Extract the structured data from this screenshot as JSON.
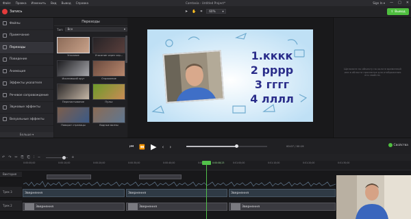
{
  "menu": [
    "Файл",
    "Правка",
    "Изменить",
    "Вид",
    "Вывод",
    "Справка"
  ],
  "app_title": "Camtasia - Untitled Project*",
  "signin": "Sign In ▾",
  "window_controls": [
    "—",
    "□",
    "✕"
  ],
  "toolbar": {
    "record_label": "Запись",
    "zoom_value": "60%",
    "export_label": "Вывод"
  },
  "nav": [
    {
      "label": "Файлы",
      "icon": "folder-icon"
    },
    {
      "label": "Примечание",
      "icon": "callout-icon"
    },
    {
      "label": "Переходы",
      "icon": "transitions-icon"
    },
    {
      "label": "Поведение",
      "icon": "behaviors-icon"
    },
    {
      "label": "Анимация",
      "icon": "animation-icon"
    },
    {
      "label": "Эффекты указателя",
      "icon": "cursor-icon"
    },
    {
      "label": "Речевое сопровождение",
      "icon": "microphone-icon"
    },
    {
      "label": "Звуковые эффекты",
      "icon": "audio-icon"
    },
    {
      "label": "Визуальные эффекты",
      "icon": "visual-effects-icon"
    }
  ],
  "nav_more": "Больше ▾",
  "panel": {
    "title": "Переходы",
    "filter_label": "Тип:",
    "filter_value": "Все",
    "tiles": [
      {
        "label": "Угасание",
        "c1": "#8c6b58",
        "c2": "#c9a28a"
      },
      {
        "label": "Угасание через чер...",
        "c1": "#262326",
        "c2": "#5a3f3c"
      },
      {
        "label": "Исказивший круг",
        "c1": "#1d1d20",
        "c2": "#a6a6ab"
      },
      {
        "label": "Отражение",
        "c1": "#6a4a3e",
        "c2": "#b8876d"
      },
      {
        "label": "Перелистывание",
        "c1": "#2d2a2a",
        "c2": "#c5b6a6"
      },
      {
        "label": "Пульс",
        "c1": "#6d9a2a",
        "c2": "#c98b55"
      },
      {
        "label": "Поворот страницы",
        "c1": "#7c5e4c",
        "c2": "#3b5a86"
      },
      {
        "label": "Водные волны",
        "c1": "#8a6b55",
        "c2": "#5f7791"
      }
    ]
  },
  "slide": {
    "lines": [
      "1.кккк",
      "2 рррр",
      "3 гггг",
      "4 лллл"
    ],
    "color": "#2a2d8a"
  },
  "props_hint": "Щелкните по объекту на холсте временной или в области просмотра для отображения его свойств.",
  "playback": {
    "time": "00:07 / 00:19",
    "progress": 0.62,
    "props_label": "Свойства"
  },
  "ruler": [
    "0:00:00;00",
    "0:00:10;00",
    "0:00:20;00",
    "0:00:30;00",
    "0:00:40;00",
    "0:00:50;00",
    "0:01:00;00",
    "0:01:10;00",
    "0:01:20;00",
    "0:01:30;00"
  ],
  "playhead_time": "0:00:08;23",
  "tracks": [
    {
      "name": "Виктория"
    },
    {
      "name": "Трек 3"
    },
    {
      "name": "Трек 2"
    }
  ],
  "clips": [
    "Звернення",
    "Звернення",
    "Звернення",
    "Звернення",
    "Звернення",
    "Звернення"
  ],
  "colors": {
    "accent": "#4fbf3f",
    "record": "#e23b3b",
    "playhead": "#52c24a"
  }
}
